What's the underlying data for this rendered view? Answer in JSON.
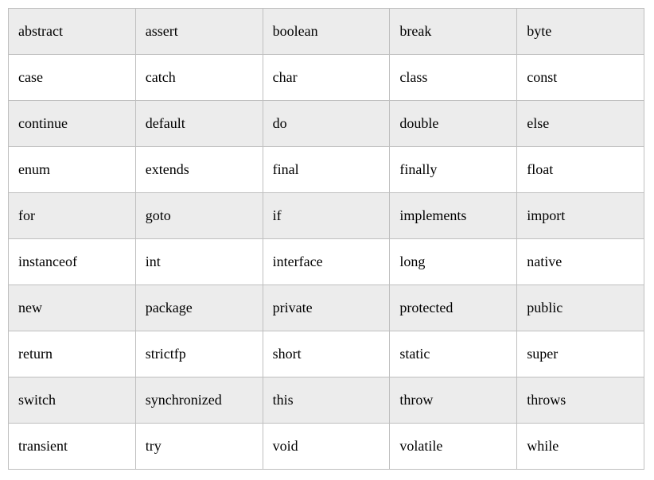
{
  "table": {
    "rows": [
      [
        "abstract",
        "assert",
        "boolean",
        "break",
        "byte"
      ],
      [
        "case",
        "catch",
        "char",
        "class",
        "const"
      ],
      [
        "continue",
        "default",
        "do",
        "double",
        "else"
      ],
      [
        "enum",
        "extends",
        "final",
        "finally",
        "float"
      ],
      [
        "for",
        "goto",
        "if",
        "implements",
        "import"
      ],
      [
        "instanceof",
        "int",
        "interface",
        "long",
        "native"
      ],
      [
        "new",
        "package",
        "private",
        "protected",
        "public"
      ],
      [
        "return",
        "strictfp",
        "short",
        "static",
        "super"
      ],
      [
        "switch",
        "synchronized",
        "this",
        "throw",
        "throws"
      ],
      [
        "transient",
        "try",
        "void",
        "volatile",
        "while"
      ]
    ]
  }
}
